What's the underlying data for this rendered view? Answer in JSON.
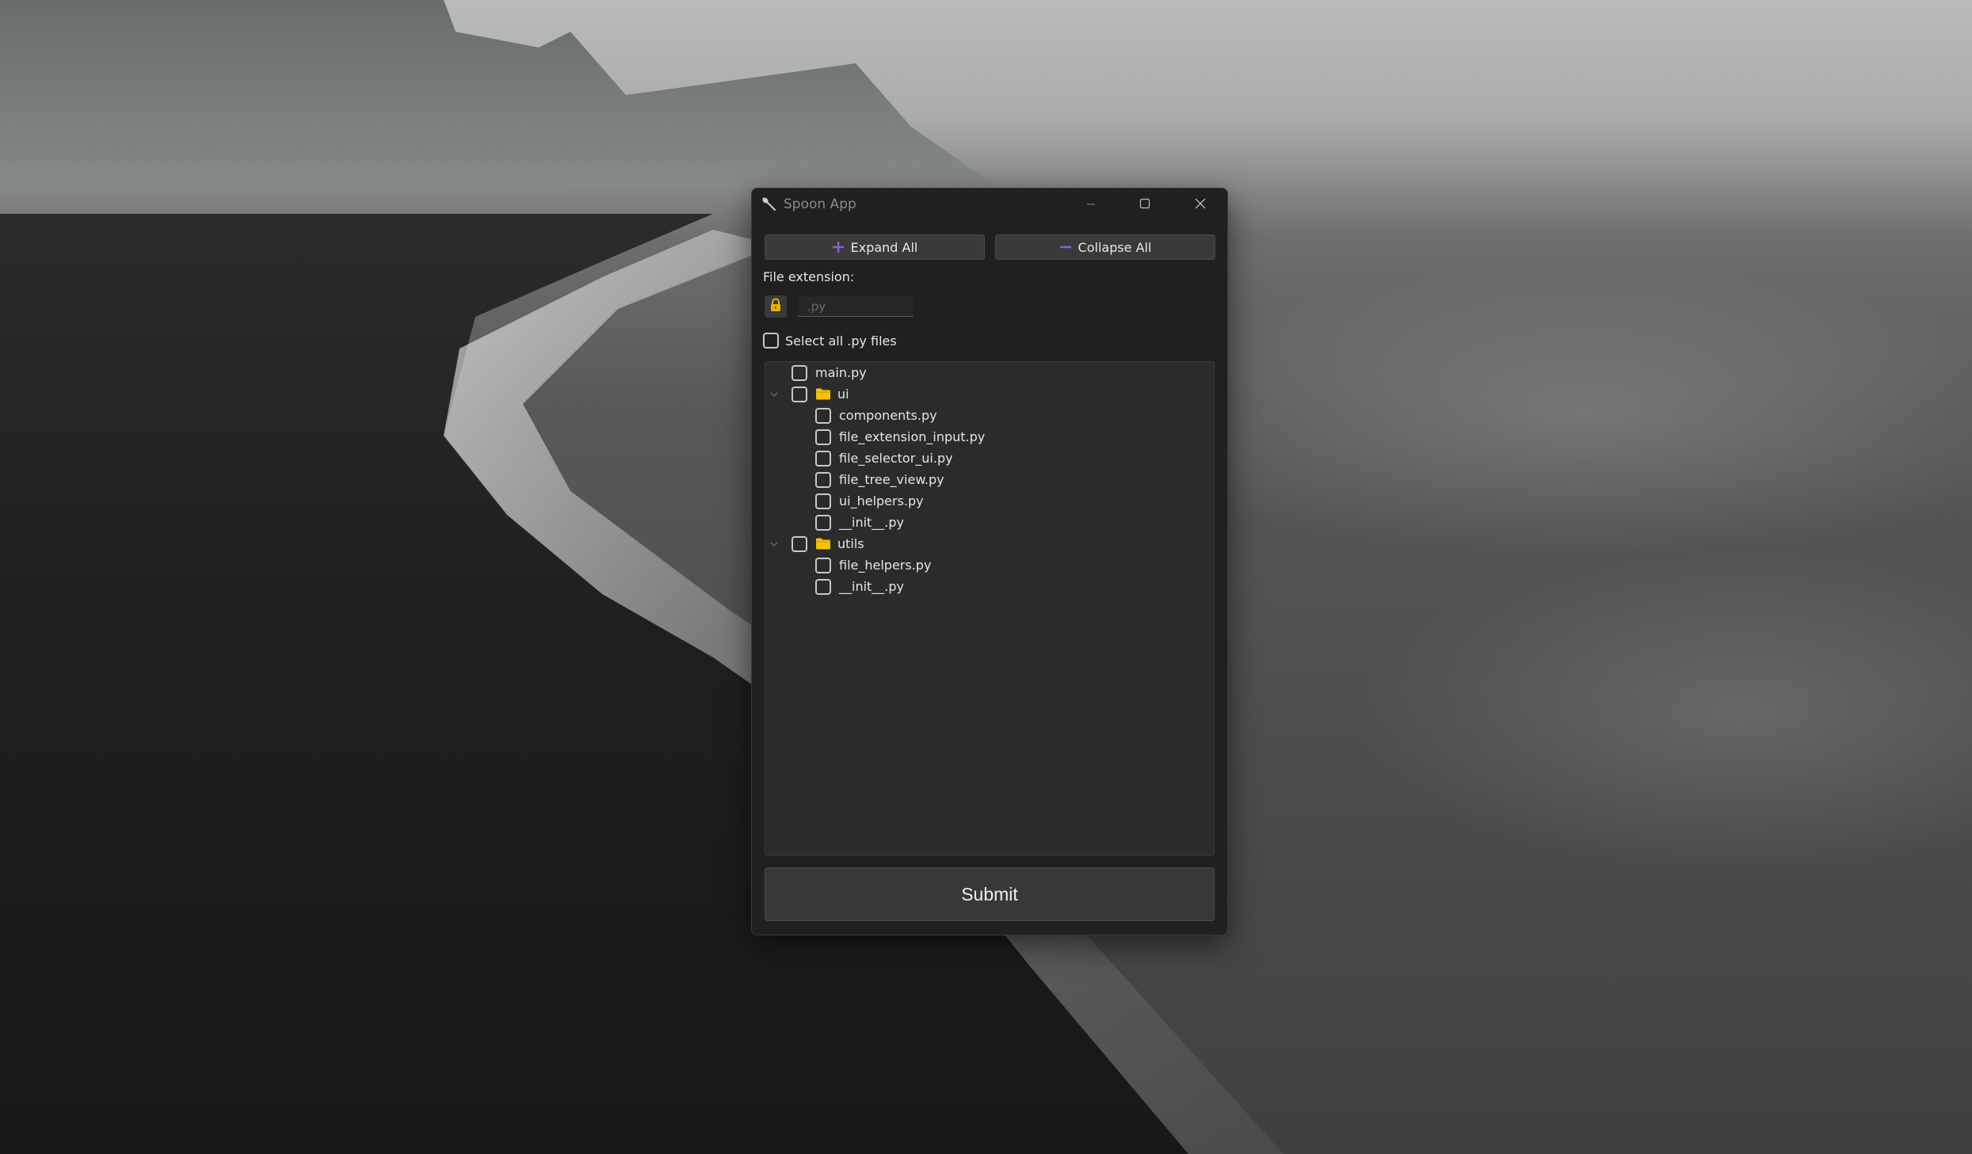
{
  "window": {
    "title": "Spoon App"
  },
  "toolbar": {
    "expand_label": "Expand All",
    "collapse_label": "Collapse All"
  },
  "extension": {
    "label": "File extension:",
    "placeholder": ".py"
  },
  "select_all": {
    "label": "Select all .py files",
    "checked": false
  },
  "tree": {
    "items": [
      {
        "label": "main.py",
        "type": "file",
        "checked": false
      },
      {
        "label": "ui",
        "type": "folder",
        "expanded": true,
        "checked": false
      },
      {
        "label": "components.py",
        "type": "file",
        "checked": false
      },
      {
        "label": "file_extension_input.py",
        "type": "file",
        "checked": false
      },
      {
        "label": "file_selector_ui.py",
        "type": "file",
        "checked": false
      },
      {
        "label": "file_tree_view.py",
        "type": "file",
        "checked": false
      },
      {
        "label": "ui_helpers.py",
        "type": "file",
        "checked": false
      },
      {
        "label": "__init__.py",
        "type": "file",
        "checked": false
      },
      {
        "label": "utils",
        "type": "folder",
        "expanded": true,
        "checked": false
      },
      {
        "label": "file_helpers.py",
        "type": "file",
        "checked": false
      },
      {
        "label": "__init__.py",
        "type": "file",
        "checked": false
      }
    ]
  },
  "submit": {
    "label": "Submit"
  },
  "colors": {
    "accent": "#8a63d2",
    "folder": "#f5c400",
    "lock": "#e8b100",
    "window_bg": "#202020",
    "tree_bg": "#2b2b2b"
  },
  "icons": {
    "app": "spoon-icon",
    "minimize": "minimize-icon",
    "maximize": "maximize-icon",
    "close": "close-icon",
    "expand": "plus-icon",
    "collapse": "minus-icon",
    "lock": "lock-icon",
    "folder": "folder-icon",
    "chevron": "chevron-down-icon"
  }
}
